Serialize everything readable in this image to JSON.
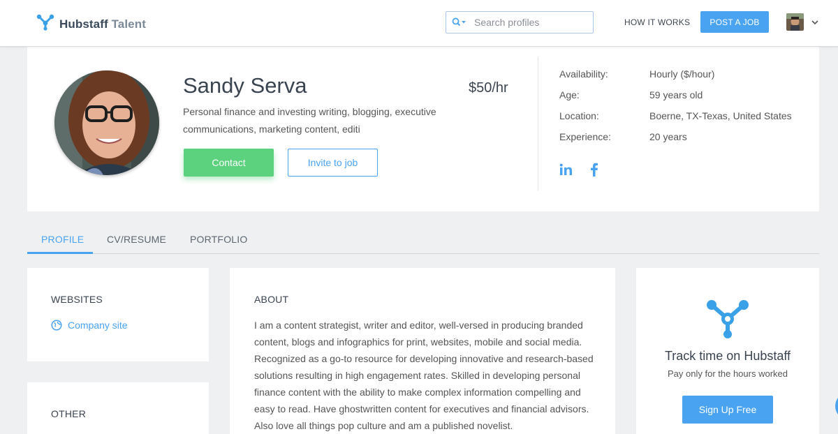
{
  "header": {
    "logo_brand": "Hubstaff",
    "logo_suffix": "Talent",
    "search_placeholder": "Search profiles",
    "how_it_works": "HOW IT WORKS",
    "post_job": "POST A JOB"
  },
  "profile": {
    "name": "Sandy Serva",
    "rate": "$50/hr",
    "headline": "Personal finance and investing writing, blogging, executive communications, marketing content, editi",
    "contact_label": "Contact",
    "invite_label": "Invite to job",
    "details": [
      {
        "label": "Availability:",
        "value": "Hourly ($/hour)"
      },
      {
        "label": "Age:",
        "value": "59 years old"
      },
      {
        "label": "Location:",
        "value": "Boerne, TX-Texas, United States"
      },
      {
        "label": "Experience:",
        "value": "20 years"
      }
    ]
  },
  "tabs": [
    {
      "label": "PROFILE",
      "active": true
    },
    {
      "label": "CV/RESUME",
      "active": false
    },
    {
      "label": "PORTFOLIO",
      "active": false
    }
  ],
  "websites": {
    "title": "WEBSITES",
    "link_label": "Company site"
  },
  "other": {
    "title": "OTHER"
  },
  "about": {
    "title": "ABOUT",
    "text": "I am a content strategist, writer and editor, well-versed in producing branded content, blogs and infographics for print, websites, mobile and social media. Recognized as a go-to resource for developing innovative and research-based solutions resulting in high engagement rates. Skilled in developing personal finance content with the ability to make complex information compelling and easy to read. Have ghostwritten content for executives and financial advisors. Also love all things pop culture and am a published novelist."
  },
  "promo": {
    "title": "Track time on Hubstaff",
    "subtitle": "Pay only for the hours worked",
    "button": "Sign Up Free"
  },
  "colors": {
    "accent": "#4aa3f0",
    "contact_green": "#5cd17e",
    "background": "#eef0f2"
  }
}
